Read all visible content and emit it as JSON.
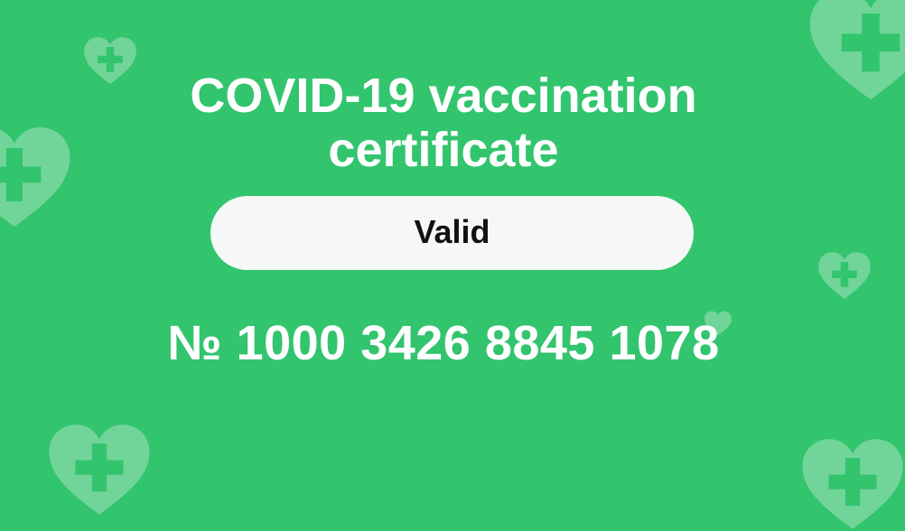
{
  "certificate": {
    "title_line1": "COVID-19 vaccination",
    "title_line2": "certificate",
    "status": "Valid",
    "number": "№ 1000 3426 8845 1078"
  },
  "colors": {
    "background": "#33c46e",
    "heart_fill": "#ffffff",
    "heart_cross": "#33c46e",
    "status_pill": "#f5f8f7",
    "status_text": "#111111",
    "title_text": "#ffffff"
  },
  "icons": {
    "decoration": "heart-with-cross-icon"
  }
}
